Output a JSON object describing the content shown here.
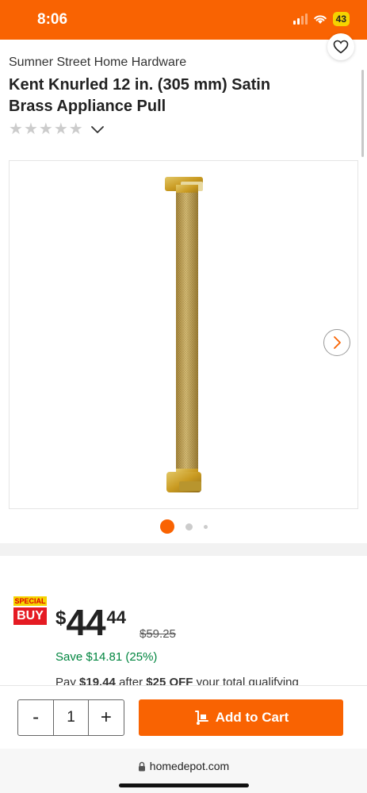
{
  "status_bar": {
    "time": "8:06",
    "battery": "43"
  },
  "product": {
    "brand": "Sumner Street Home Hardware",
    "title": "Kent Knurled 12 in. (305 mm) Satin Brass Appliance Pull",
    "rating": 0,
    "rating_max": 5,
    "image_count": 3,
    "active_image": 1
  },
  "icons": {
    "favorite": "heart-icon",
    "rating_toggle": "chevron-down-icon",
    "next_image": "chevron-right-icon",
    "cart": "dolly-icon",
    "lock": "lock-icon"
  },
  "pricing": {
    "badge_top": "SPECIAL",
    "badge_bottom": "BUY",
    "currency": "$",
    "dollars": "44",
    "cents": "44",
    "was": "$59.25",
    "save": "Save $14.81 (25%)",
    "promo_prefix": "Pay ",
    "promo_amount": "$19.44",
    "promo_middle": " after ",
    "promo_offer": "$25 OFF",
    "promo_suffix": " your total qualifying"
  },
  "cart": {
    "decrement": "-",
    "quantity": "1",
    "increment": "+",
    "add_label": "Add to Cart"
  },
  "browser": {
    "url": "homedepot.com"
  },
  "colors": {
    "brand_orange": "#f96302",
    "save_green": "#00853f",
    "badge_yellow": "#f5d300",
    "badge_red": "#e51b23",
    "brass": "#c9a646"
  }
}
